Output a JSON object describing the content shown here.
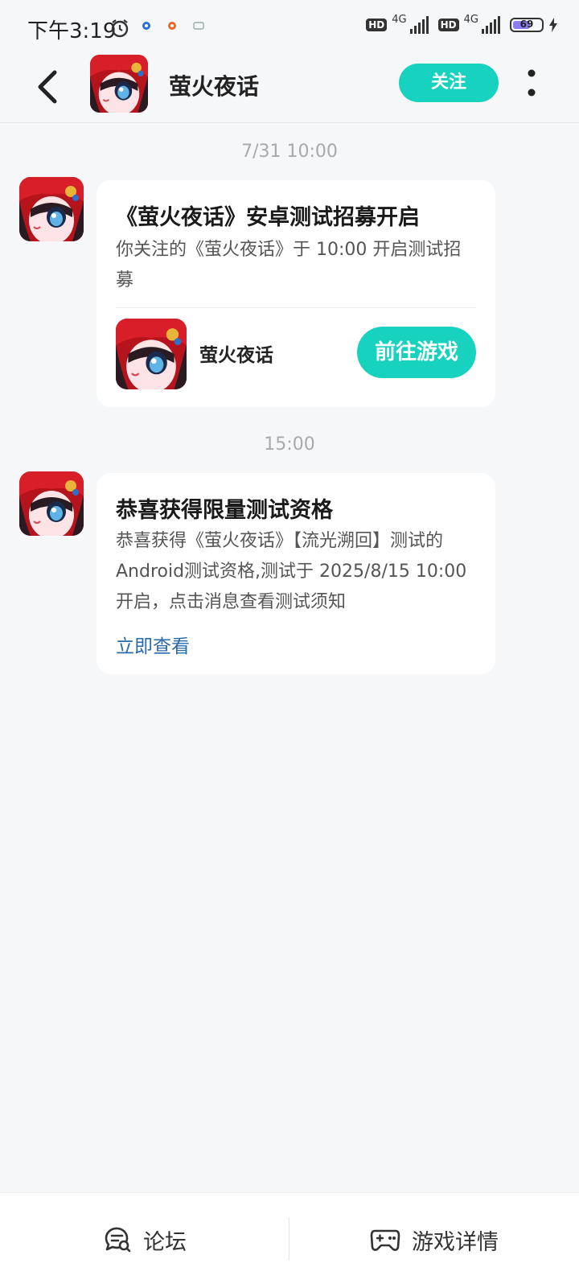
{
  "status_bar": {
    "time": "下午3:19",
    "network_1": "4G",
    "network_2": "4G",
    "hd_1": "HD",
    "hd_2": "HD",
    "battery": "69"
  },
  "header": {
    "title": "萤火夜话",
    "follow_label": "关注"
  },
  "messages": [
    {
      "time": "7/31  10:00",
      "title": "《萤火夜话》安卓测试招募开启",
      "body": "你关注的《萤火夜话》于 10:00 开启测试招募",
      "game_name": "萤火夜话",
      "action_label": "前往游戏"
    },
    {
      "time": "15:00",
      "title": "恭喜获得限量测试资格",
      "body": "恭喜获得《萤火夜话》【流光溯回】测试的Android测试资格,测试于 2025/8/15 10:00 开启，点击消息查看测试须知",
      "link_label": "立即查看"
    }
  ],
  "bottom_bar": {
    "forum_label": "论坛",
    "detail_label": "游戏详情"
  },
  "colors": {
    "accent": "#16d2be",
    "link": "#2b6aa8",
    "background": "#f6f7f9"
  }
}
